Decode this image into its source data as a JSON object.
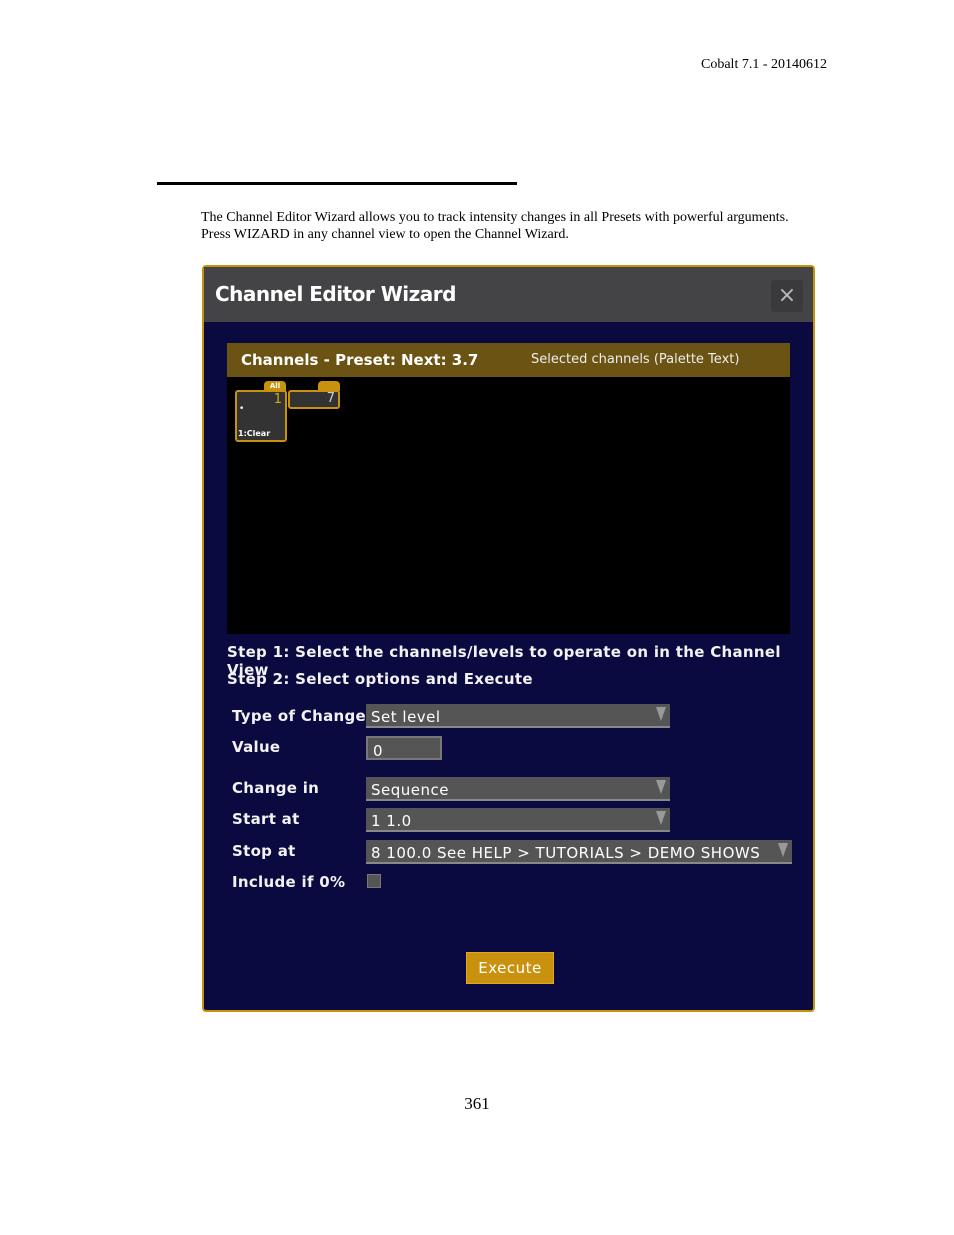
{
  "header": {
    "doc_version": "Cobalt 7.1 - 20140612"
  },
  "intro": "The Channel Editor Wizard allows you to track intensity changes in all Presets with powerful arguments. Press WIZARD in any channel view to open the Channel Wizard.",
  "page_number": "361",
  "dialog": {
    "title": "Channel Editor Wizard",
    "close_icon": "×",
    "channels_header": {
      "title": "Channels - Preset:",
      "next": "Next: 3.7",
      "selected": "Selected channels (Palette Text)"
    },
    "channel_tiles": [
      {
        "tab": "All",
        "number": "1",
        "label": "1:Clear"
      },
      {
        "tab": "",
        "number": "7"
      }
    ],
    "steps": [
      "Step 1: Select the channels/levels to operate on in the Channel View",
      "Step 2: Select options and Execute"
    ],
    "fields": {
      "type_of_change": {
        "label": "Type of Change",
        "value": "Set level"
      },
      "value": {
        "label": "Value",
        "value": "0"
      },
      "change_in": {
        "label": "Change in",
        "value": "Sequence"
      },
      "start_at": {
        "label": "Start at",
        "value": "1 1.0"
      },
      "stop_at": {
        "label": "Stop at",
        "value": "8 100.0 See HELP > TUTORIALS > DEMO SHOWS"
      },
      "include_if_zero": {
        "label": "Include if 0%",
        "checked": false
      }
    },
    "execute_label": "Execute",
    "colors": {
      "accent": "#c8920e",
      "background": "#0a0a40",
      "titlebar": "#444446",
      "channel_header": "#6b5313"
    }
  }
}
